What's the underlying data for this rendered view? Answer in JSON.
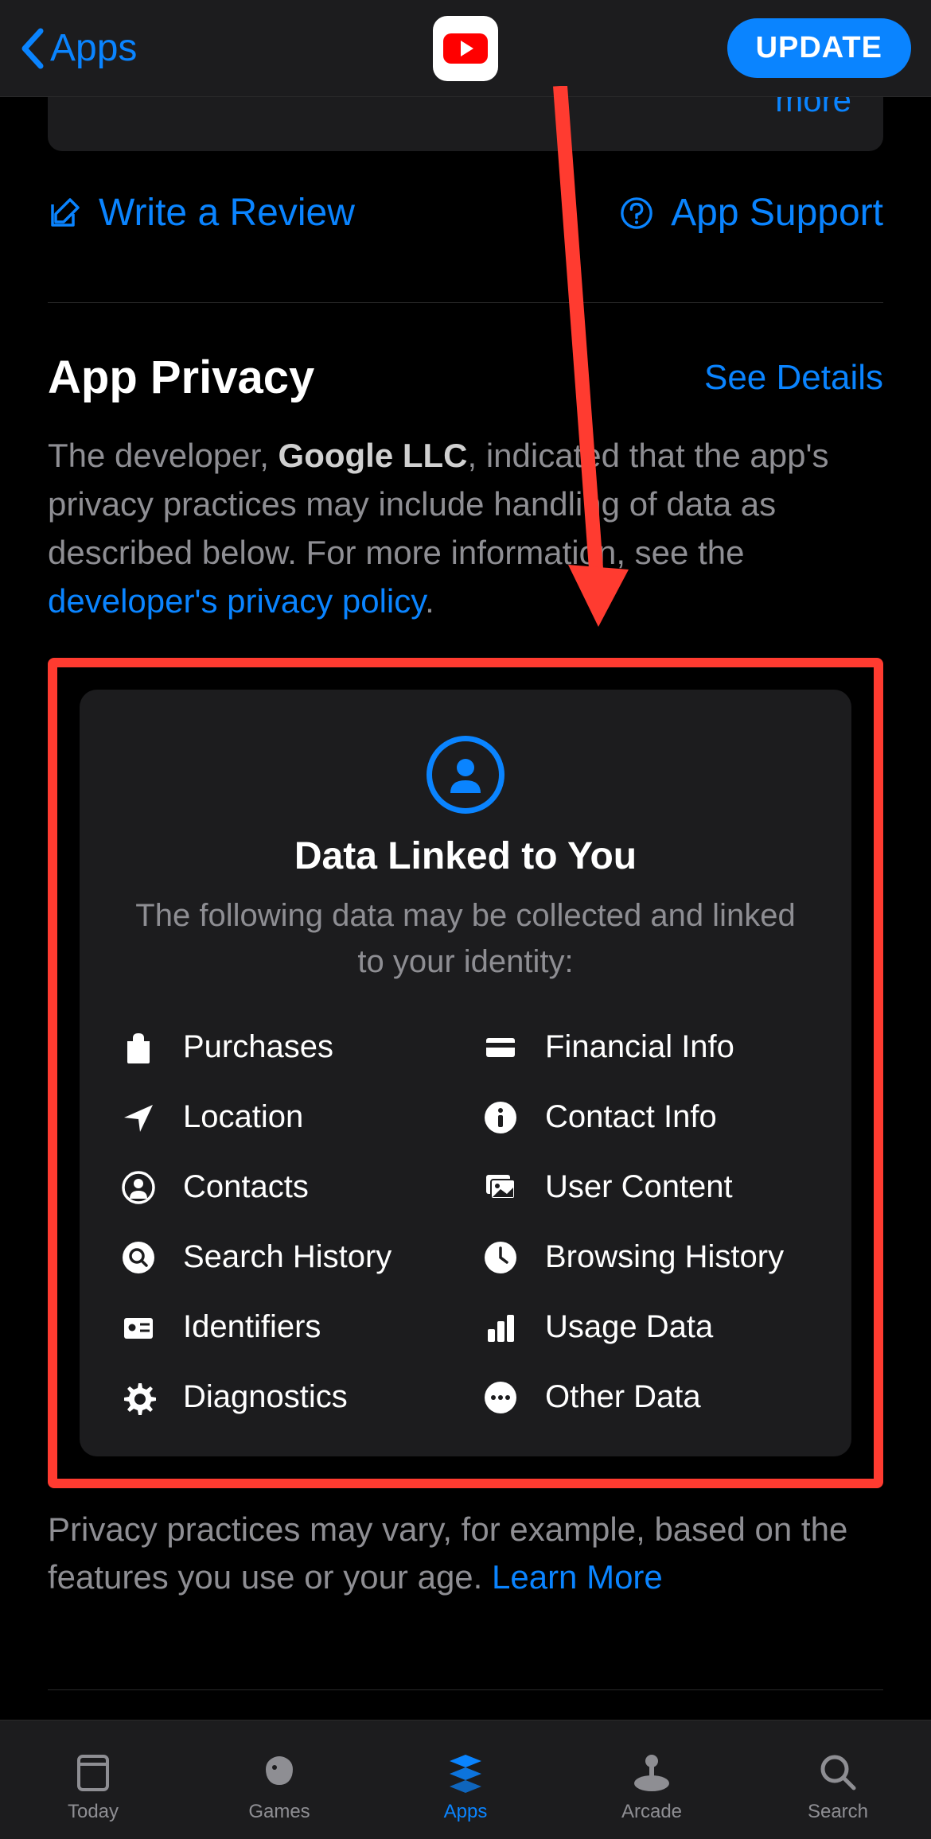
{
  "nav": {
    "back_label": "Apps",
    "app_name": "YouTube",
    "action_button": "UPDATE"
  },
  "review_card": {
    "more_link": "more"
  },
  "actions": {
    "write_review": "Write a Review",
    "app_support": "App Support"
  },
  "privacy": {
    "heading": "App Privacy",
    "see_details": "See Details",
    "intro_part1": "The developer, ",
    "developer": "Google LLC",
    "intro_part2": ", indicated that the app's privacy practices may include handling of data as described below. For more information, see the ",
    "policy_link": "developer's privacy policy",
    "intro_part3": ".",
    "card": {
      "title": "Data Linked to You",
      "subtitle": "The following data may be collected and linked to your identity:",
      "items": [
        {
          "icon": "bag",
          "label": "Purchases"
        },
        {
          "icon": "card",
          "label": "Financial Info"
        },
        {
          "icon": "location",
          "label": "Location"
        },
        {
          "icon": "info",
          "label": "Contact Info"
        },
        {
          "icon": "person",
          "label": "Contacts"
        },
        {
          "icon": "photos",
          "label": "User Content"
        },
        {
          "icon": "search",
          "label": "Search History"
        },
        {
          "icon": "clock",
          "label": "Browsing History"
        },
        {
          "icon": "id",
          "label": "Identifiers"
        },
        {
          "icon": "chart",
          "label": "Usage Data"
        },
        {
          "icon": "gear",
          "label": "Diagnostics"
        },
        {
          "icon": "dots",
          "label": "Other Data"
        }
      ]
    },
    "footer_part1": "Privacy practices may vary, for example, based on the features you use or your age. ",
    "learn_more": "Learn More"
  },
  "tabs": [
    {
      "id": "today",
      "label": "Today"
    },
    {
      "id": "games",
      "label": "Games"
    },
    {
      "id": "apps",
      "label": "Apps"
    },
    {
      "id": "arcade",
      "label": "Arcade"
    },
    {
      "id": "search",
      "label": "Search"
    }
  ],
  "active_tab": "apps",
  "colors": {
    "accent": "#0a84ff",
    "highlight": "#ff3b30"
  }
}
